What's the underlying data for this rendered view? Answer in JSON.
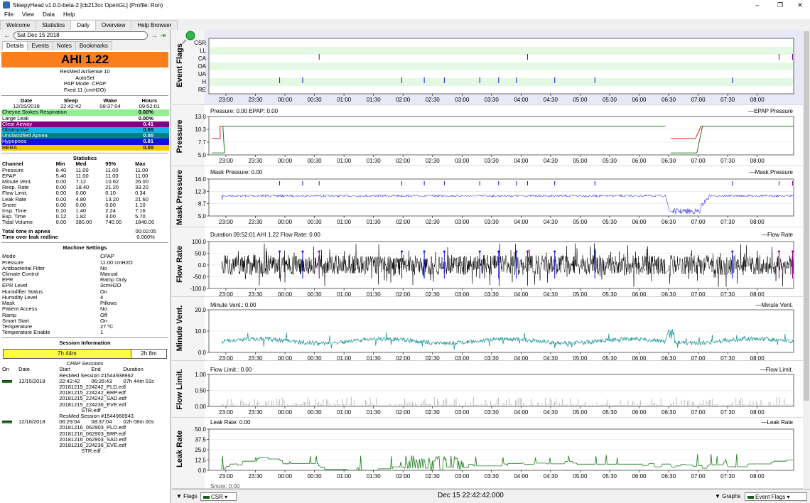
{
  "window": {
    "title": "SleepyHead v1.0.0-beta-2 [cb213cc OpenGL] (Profile: Ron)"
  },
  "menu": [
    "File",
    "View",
    "Data",
    "Help"
  ],
  "tabs": [
    "Welcome",
    "Statistics",
    "Daily",
    "Overview",
    "Help Browser"
  ],
  "nav": {
    "date": "Sat Dec 15 2018"
  },
  "subtabs": [
    "Details",
    "Events",
    "Notes",
    "Bookmarks"
  ],
  "summary": {
    "ahi": "AHI 1.22",
    "machine": "ResMed AirSense 10",
    "machine_model": "AutoSet",
    "pap_mode": "PAP Mode: CPAP",
    "pressure": "Fxed 11 (cmH2O)",
    "headers": [
      "Date",
      "Sleep",
      "Wake",
      "Hours"
    ],
    "values": [
      "12/15/2018",
      "22:42:42",
      "08:37:04",
      "09:52:01"
    ]
  },
  "events": [
    {
      "label": "Cheyne Stokes Respiration",
      "value": "0.00%",
      "bg": "#90f090",
      "fg": "#000000"
    },
    {
      "label": "Large Leak",
      "value": "0.00%",
      "bg": "#ffffff",
      "fg": "#000000"
    },
    {
      "label": "Clear Airway",
      "value": "0.41",
      "bg": "#800080",
      "fg": "#ffffff"
    },
    {
      "label": "Obstructive",
      "value": "0.00",
      "bg": "#18b0e8",
      "fg": "#000000"
    },
    {
      "label": "Unclassified Apnea",
      "value": "0.00",
      "bg": "#008080",
      "fg": "#ffffff"
    },
    {
      "label": "Hypopnea",
      "value": "0.81",
      "bg": "#1010e0",
      "fg": "#ffffff"
    },
    {
      "label": "RERA",
      "value": "0.00",
      "bg": "#f0c800",
      "fg": "#000000"
    }
  ],
  "statistics": {
    "title": "Statistics",
    "columns": [
      "Channel",
      "Min",
      "Med",
      "95%",
      "Max"
    ],
    "rows": [
      [
        "Pressure",
        "8.40",
        "11.00",
        "11.00",
        "11.00"
      ],
      [
        "EPAP",
        "5.40",
        "11.00",
        "11.00",
        "11.00"
      ],
      [
        "Minute Vent.",
        "0.00",
        "7.12",
        "10.62",
        "26.00"
      ],
      [
        "Resp. Rate",
        "0.00",
        "18.40",
        "21.20",
        "33.20"
      ],
      [
        "Flow Limit.",
        "0.00",
        "0.00",
        "0.10",
        "0.34"
      ],
      [
        "Leak Rate",
        "0.00",
        "4.80",
        "13.20",
        "21.60"
      ],
      [
        "Snore",
        "0.00",
        "0.00",
        "0.00",
        "1.10"
      ],
      [
        "Insp. Time",
        "0.10",
        "1.40",
        "2.24",
        "7.16"
      ],
      [
        "Exp. Time",
        "0.12",
        "1.82",
        "3.00",
        "5.70"
      ],
      [
        "Tidal Volume",
        "0.00",
        "380.00",
        "740.00",
        "1840.00"
      ]
    ],
    "apnea_label": "Total time in apnea",
    "apnea_value": "00:02:05",
    "leak_label": "Time over leak redline",
    "leak_value": "0.000%"
  },
  "machine_settings": {
    "title": "Machine Settings",
    "rows": [
      [
        "Mode",
        "CPAP"
      ],
      [
        "Pressure",
        "11.00 cmH2O"
      ],
      [
        "Antibacterial Filter",
        "No"
      ],
      [
        "Climate Control",
        "Manual"
      ],
      [
        "EPR",
        "Ramp Only"
      ],
      [
        "EPR Level",
        "3cmH2O"
      ],
      [
        "Humidifier Status",
        "On"
      ],
      [
        "Humidity Level",
        "4"
      ],
      [
        "Mask",
        "Pillows"
      ],
      [
        "Patient Access",
        "No"
      ],
      [
        "Ramp",
        "Off"
      ],
      [
        "Smart Start",
        "On"
      ],
      [
        "Temperature",
        "27 ºC"
      ],
      [
        "Temperature Enable",
        "1"
      ]
    ]
  },
  "session_info": {
    "title": "Session Information",
    "bar": [
      {
        "label": "7h 44m",
        "fraction": 0.785,
        "color": "#ffff40"
      },
      {
        "label": "2h 8m",
        "fraction": 0.215,
        "color": "#ffffff"
      }
    ],
    "cpap_title": "CPAP Sessions",
    "headers": [
      "On",
      "Date",
      "Start",
      "End",
      "Duration"
    ],
    "sessions": [
      {
        "name": "ResMed Session #1544938962",
        "date": "12/15/2018",
        "start": "22:42:42",
        "end": "06:26:43",
        "duration": "07h 44m 01s",
        "files": [
          "20181215_224242_PLD.edf",
          "20181215_224242_BRP.edf",
          "20181215_224242_SAD.edf",
          "20181215_224236_EVE.edf",
          "STR.edf"
        ]
      },
      {
        "name": "ResMed Session #1544966943",
        "date": "12/16/2018",
        "start": "06:29:04",
        "end": "08:37:04",
        "duration": "02h 08m 00s",
        "files": [
          "20181216_062903_PLD.edf",
          "20181216_062903_BRP.edf",
          "20181216_062903_SAD.edf",
          "20181216_224236_EVE.edf",
          "STR.edf"
        ]
      }
    ]
  },
  "time_ticks": [
    "23:00",
    "23:30",
    "00:00",
    "00:30",
    "01:00",
    "01:30",
    "02:00",
    "02:30",
    "03:00",
    "03:30",
    "04:00",
    "04:30",
    "05:00",
    "05:30",
    "06:00",
    "06:30",
    "07:00",
    "07:30",
    "08:00"
  ],
  "graphs": {
    "event_flags": {
      "title": "Event Flags",
      "rows": [
        "CSR",
        "LL",
        "CA",
        "OA",
        "UA",
        "H",
        "RE"
      ]
    },
    "pressure": {
      "title": "Pressure",
      "header": "Pressure: 0.00 EPAP: 0.00",
      "legend": "EPAP Pressure",
      "yticks": [
        "13.0",
        "10.3",
        "7.7",
        "5.0"
      ]
    },
    "mask_pressure": {
      "title": "Mask Pressure",
      "header": "Mask Pressure: 0.00",
      "legend": "Mask Pressure",
      "yticks": [
        "16.0",
        "12.3",
        "8.7",
        "5.0"
      ]
    },
    "flow_rate": {
      "title": "Flow Rate",
      "header": "Duration 09:52:01 AHI 1.22 Flow Rate: 0.00",
      "legend": "Flow Rate",
      "yticks": [
        "100.0",
        "50.0",
        "0.0",
        "-50.0",
        "-100.0"
      ]
    },
    "minute_vent": {
      "title": "Minute Vent.",
      "header": "Minute Vent.: 0.00",
      "legend": "Minute Vent.",
      "yticks": [
        "20.0",
        "10.0",
        "0.0"
      ]
    },
    "flow_limit": {
      "title": "Flow Limit.",
      "header": "Flow Limit.: 0.00",
      "legend": "Flow Limit.",
      "yticks": [
        "1.00",
        "0.50",
        "0.00"
      ]
    },
    "leak_rate": {
      "title": "Leak Rate",
      "header": "Leak Rate: 0.00",
      "legend": "Leak Rate",
      "yticks": [
        "50.0",
        "37.5",
        "25.0",
        "12.5",
        "0.0"
      ]
    }
  },
  "bottom": {
    "flags": "Flags",
    "csr": "CSR",
    "timestamp": "Dec 15 22:42:42.000",
    "graphs": "Graphs",
    "event_flags": "Event Flags"
  },
  "colors": {
    "ahi_bg": "#fa7f1c",
    "pressure": "#1a7a1a",
    "epap": "#d02020",
    "mask": "#1010e0",
    "flow": "#000000",
    "minvent": "#109090",
    "flowlimit": "#a0a0a0",
    "leak": "#1a7a1a"
  }
}
